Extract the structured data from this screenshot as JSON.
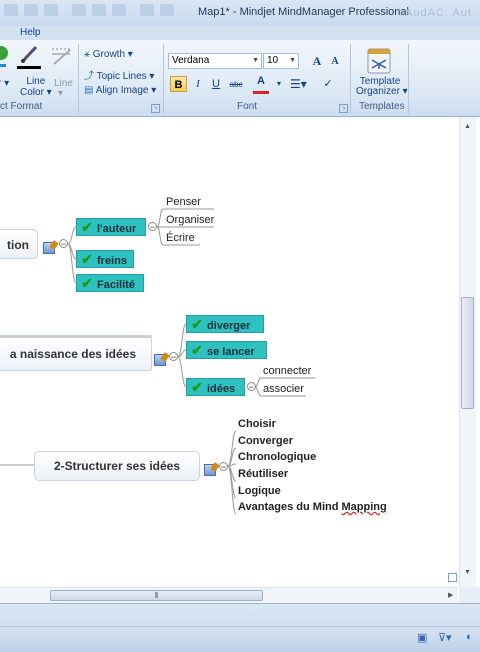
{
  "window": {
    "title": "Map1* - Mindjet MindManager Professional",
    "blurred_title_fragment": "AudAC: Aut"
  },
  "ribbon": {
    "tab_help": "Help",
    "object_format": {
      "line_color_label": "Line\nColor",
      "line_label": "Line",
      "group_label": "ct Format"
    },
    "layout": {
      "growth": "Growth",
      "topic_lines": "Topic Lines",
      "align_image": "Align Image"
    },
    "font": {
      "font_name": "Verdana",
      "font_size": "10",
      "bold": "B",
      "italic": "I",
      "underline": "U",
      "strike": "abc",
      "color_a": "A",
      "grow": "A",
      "shrink": "A",
      "group_label": "Font"
    },
    "templates": {
      "organizer_label_1": "Template",
      "organizer_label_2": "Organizer",
      "group_label": "Templates"
    }
  },
  "map": {
    "branch1": {
      "title": "tion",
      "children": [
        {
          "label": "l'auteur",
          "checked": true,
          "children": [
            "Penser",
            "Organiser",
            "Écrire"
          ]
        },
        {
          "label": "freins",
          "checked": true
        },
        {
          "label": "Facilité",
          "checked": true
        }
      ]
    },
    "branch2": {
      "title": "a naissance des idées",
      "children": [
        {
          "label": "diverger",
          "checked": true
        },
        {
          "label": "se lancer",
          "checked": true
        },
        {
          "label": "idées",
          "checked": true,
          "children": [
            "connecter",
            "associer"
          ]
        }
      ]
    },
    "branch3": {
      "title": "2-Structurer ses idées",
      "children": [
        "Choisir",
        "Converger",
        "Chronologique",
        "Réutiliser",
        "Logique",
        "Avantages du Mind Mapping"
      ]
    }
  },
  "icons": {
    "check": "check-icon",
    "note": "note-icon",
    "collapse": "collapse-icon"
  }
}
